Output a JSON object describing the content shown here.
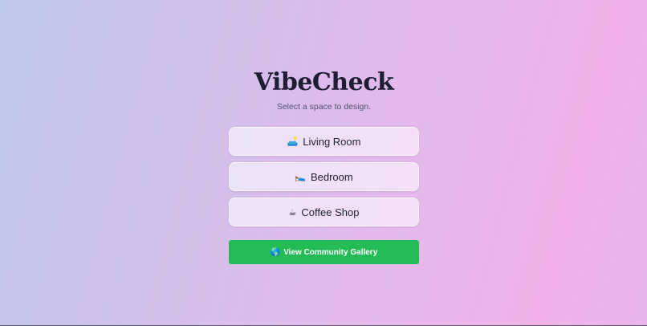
{
  "app": {
    "title": "VibeCheck",
    "subtitle": "Select a space to design."
  },
  "spaces": [
    {
      "icon": "🛋️",
      "icon_name": "couch-icon",
      "label": "Living Room"
    },
    {
      "icon": "🛌",
      "icon_name": "bed-icon",
      "label": "Bedroom"
    },
    {
      "icon": "☕",
      "icon_name": "coffee-icon",
      "label": "Coffee Shop"
    }
  ],
  "gallery": {
    "icon": "🌎",
    "icon_name": "globe-icon",
    "label": "View Community Gallery"
  },
  "colors": {
    "accent_green": "#22bb56",
    "title": "#1f1d33"
  }
}
